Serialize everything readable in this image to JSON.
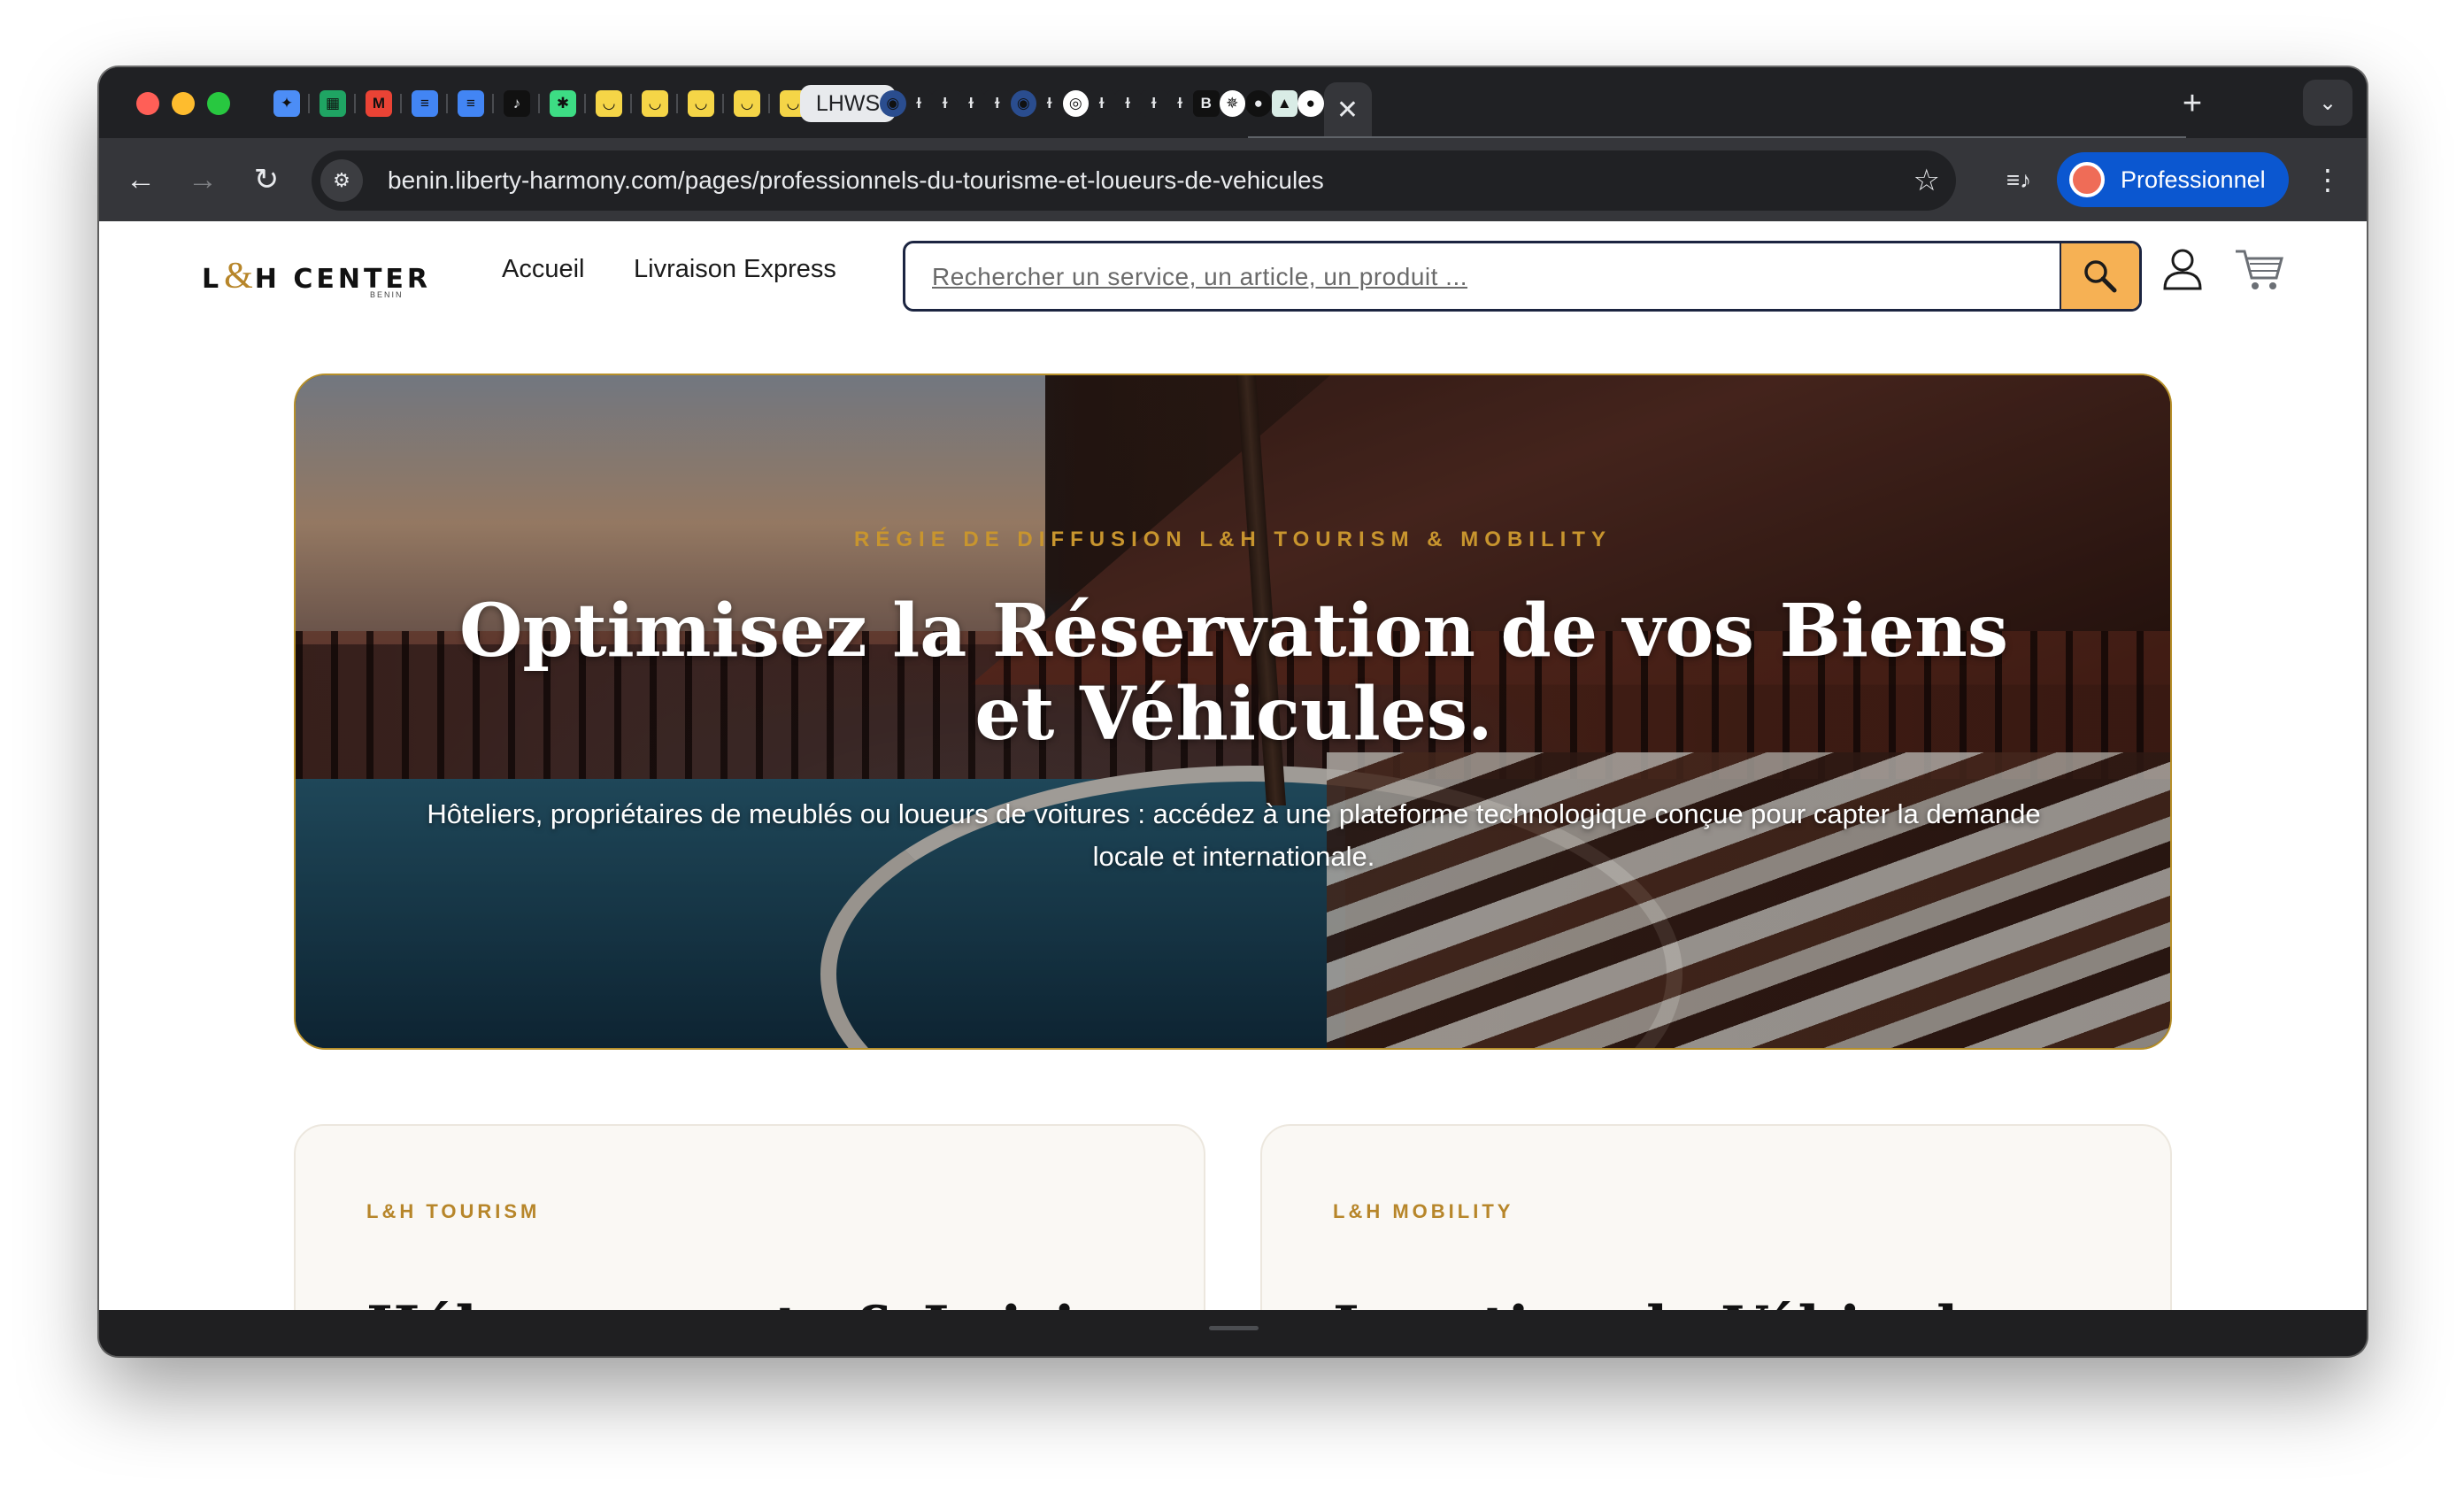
{
  "browser": {
    "tabs": [
      {
        "icon": "gemini-icon",
        "color": "#4c8df6",
        "glyph": "✦"
      },
      {
        "icon": "google-sheets-icon",
        "color": "#1fa463",
        "glyph": "▦"
      },
      {
        "icon": "gmail-icon",
        "color": "#ea4335",
        "glyph": "M"
      },
      {
        "icon": "google-docs-icon",
        "color": "#4285f4",
        "glyph": "≡"
      },
      {
        "icon": "google-docs-icon",
        "color": "#4285f4",
        "glyph": "≡"
      },
      {
        "icon": "tiktok-icon",
        "color": "#111111",
        "glyph": "♪"
      },
      {
        "icon": "green-star-icon",
        "color": "#3ddc84",
        "glyph": "✱"
      },
      {
        "icon": "yellow-app-icon",
        "color": "#f5d547",
        "glyph": "◡"
      },
      {
        "icon": "yellow-app-icon",
        "color": "#f5d547",
        "glyph": "◡"
      },
      {
        "icon": "yellow-app-icon",
        "color": "#f5d547",
        "glyph": "◡"
      },
      {
        "icon": "yellow-app-icon",
        "color": "#f5d547",
        "glyph": "◡"
      },
      {
        "icon": "yellow-app-icon",
        "color": "#f5d547",
        "glyph": "◡"
      }
    ],
    "lhws_tab": "LHWS",
    "grouped_tabs": [
      {
        "icon": "lh-blue-icon",
        "color": "#2a4d8f",
        "glyph": "◉"
      },
      {
        "icon": "lh-logo-icon",
        "color": "#202124",
        "glyph": "ɫ"
      },
      {
        "icon": "lh-logo-icon",
        "color": "#202124",
        "glyph": "ɫ"
      },
      {
        "icon": "lh-logo-icon",
        "color": "#202124",
        "glyph": "ɫ"
      },
      {
        "icon": "lh-logo-icon",
        "color": "#202124",
        "glyph": "ɫ"
      },
      {
        "icon": "lh-blue-icon",
        "color": "#2a4d8f",
        "glyph": "◉"
      },
      {
        "icon": "lh-logo-icon",
        "color": "#202124",
        "glyph": "ɫ"
      },
      {
        "icon": "white-circle-icon",
        "color": "#ffffff",
        "glyph": "◎"
      },
      {
        "icon": "lh-logo-icon",
        "color": "#202124",
        "glyph": "ɫ"
      },
      {
        "icon": "lh-logo-icon",
        "color": "#202124",
        "glyph": "ɫ"
      },
      {
        "icon": "lh-logo-icon",
        "color": "#202124",
        "glyph": "ɫ"
      },
      {
        "icon": "lh-logo-icon",
        "color": "#202124",
        "glyph": "ɫ"
      },
      {
        "icon": "b-icon",
        "color": "#111111",
        "glyph": "B"
      },
      {
        "icon": "compass-icon",
        "color": "#ffffff",
        "glyph": "✵"
      },
      {
        "icon": "dark-circle-icon",
        "color": "#111111",
        "glyph": "●"
      },
      {
        "icon": "landscape-icon",
        "color": "#d9ece6",
        "glyph": "▲"
      },
      {
        "icon": "white-circle-icon",
        "color": "#ffffff",
        "glyph": "●"
      }
    ],
    "close_glyph": "✕",
    "new_tab_glyph": "+",
    "url": "benin.liberty-harmony.com/pages/professionnels-du-tourisme-et-loueurs-de-vehicules",
    "profile_label": "Professionnel"
  },
  "header": {
    "logo_left": "L",
    "logo_amp": "&",
    "logo_right": "H CENTER",
    "logo_sub": "BENIN",
    "nav": [
      "Accueil",
      "Livraison Express"
    ],
    "search_placeholder": "Rechercher un service, un article, un produit ..."
  },
  "hero": {
    "eyebrow": "RÉGIE DE DIFFUSION L&H TOURISM & MOBILITY",
    "title": "Optimisez la Réservation de vos Biens et Véhicules.",
    "lead": "Hôteliers, propriétaires de meublés ou loueurs de voitures : accédez à une plateforme technologique conçue pour capter la demande locale et internationale."
  },
  "cards": [
    {
      "kicker": "L&H TOURISM",
      "title": "Hébergements & Loisirs"
    },
    {
      "kicker": "L&H MOBILITY",
      "title": "Location de Véhicules"
    }
  ],
  "colors": {
    "accent_gold": "#b7862a",
    "search_button": "#f6b154",
    "profile_blue": "#0b57d0"
  }
}
